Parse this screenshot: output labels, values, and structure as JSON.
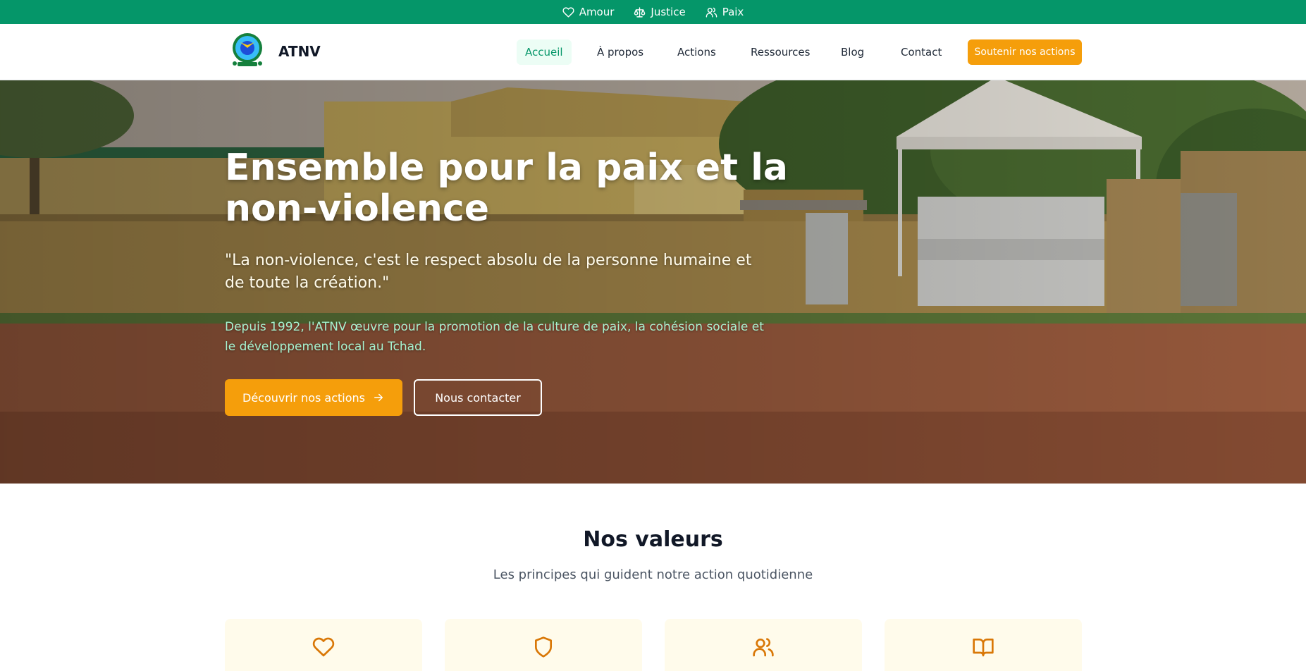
{
  "topbar": {
    "items": [
      {
        "label": "Amour",
        "icon": "heart-icon"
      },
      {
        "label": "Justice",
        "icon": "scales-icon"
      },
      {
        "label": "Paix",
        "icon": "users-icon"
      }
    ]
  },
  "header": {
    "brand": "ATNV",
    "nav": [
      "Accueil",
      "À propos",
      "Actions",
      "Ressources",
      "Blog",
      "Contact"
    ],
    "active": "Accueil",
    "cta": "Soutenir nos actions"
  },
  "hero": {
    "title": "Ensemble pour la paix et la non-violence",
    "quote": "\"La non-violence, c'est le respect absolu de la personne humaine et de toute la création.\"",
    "description": "Depuis 1992, l'ATNV œuvre pour la promotion de la culture de paix, la cohésion sociale et le développement local au Tchad.",
    "primary_button": "Découvrir nos actions",
    "secondary_button": "Nous contacter"
  },
  "values": {
    "title": "Nos valeurs",
    "subtitle": "Les principes qui guident notre action quotidienne",
    "cards": [
      {
        "icon": "heart-icon"
      },
      {
        "icon": "shield-icon"
      },
      {
        "icon": "users-icon"
      },
      {
        "icon": "book-icon"
      }
    ]
  },
  "colors": {
    "green": "#059669",
    "amber": "#f59e0b",
    "card_bg": "#fffbeb"
  }
}
